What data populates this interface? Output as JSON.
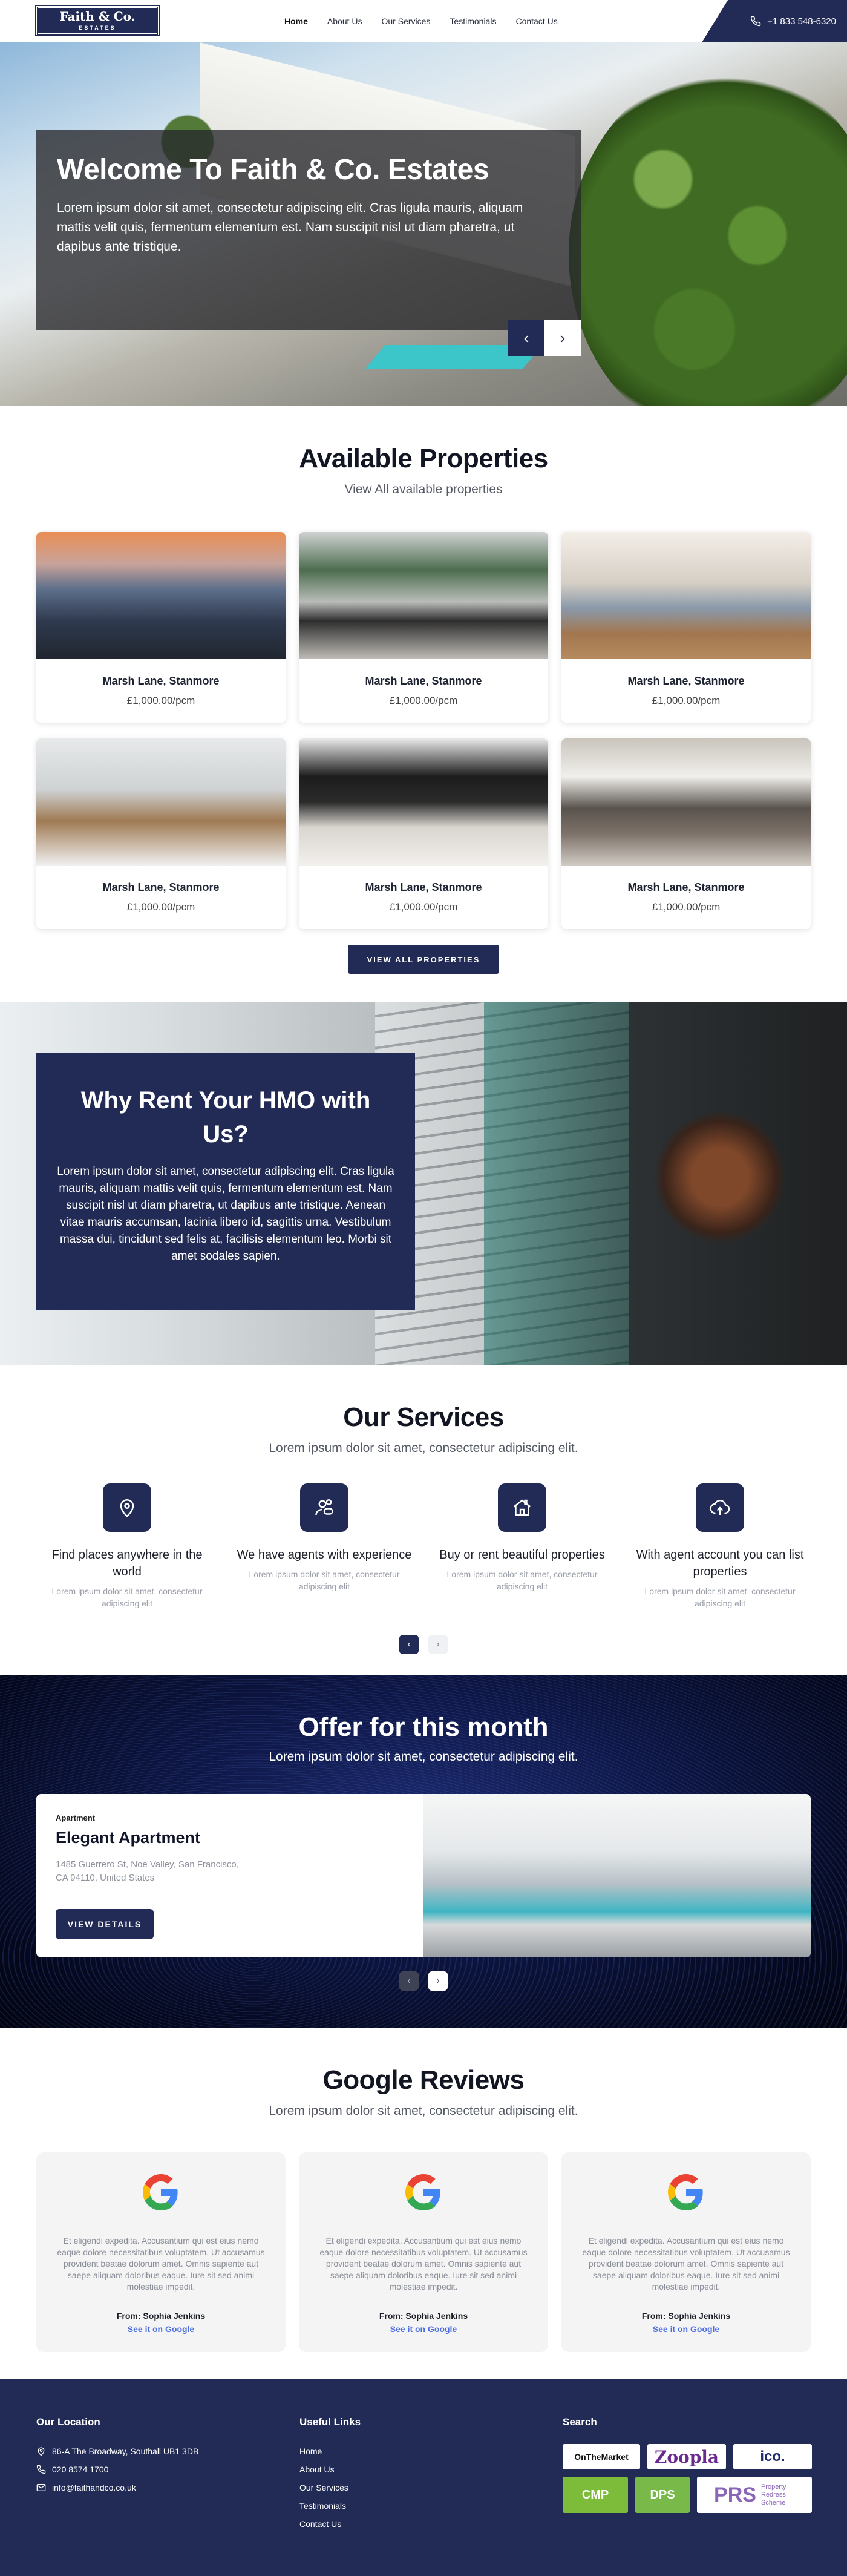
{
  "nav": {
    "logo_line1": "Faith & Co.",
    "logo_line2": "ESTATES",
    "links": [
      "Home",
      "About Us",
      "Our Services",
      "Testimonials",
      "Contact Us"
    ],
    "phone": "+1 833 548-6320"
  },
  "hero": {
    "title": "Welcome To Faith & Co. Estates",
    "text": "Lorem ipsum dolor sit amet, consectetur adipiscing elit. Cras ligula mauris, aliquam mattis velit quis, fermentum elementum est. Nam suscipit nisl ut diam pharetra, ut dapibus ante tristique.",
    "prev_icon": "chevron-left-icon",
    "next_icon": "chevron-right-icon"
  },
  "properties": {
    "title": "Available Properties",
    "subtitle": "View All available properties",
    "items": [
      {
        "name": "Marsh Lane, Stanmore",
        "price": "£1,000.00/pcm"
      },
      {
        "name": "Marsh Lane, Stanmore",
        "price": "£1,000.00/pcm"
      },
      {
        "name": "Marsh Lane, Stanmore",
        "price": "£1,000.00/pcm"
      },
      {
        "name": "Marsh Lane, Stanmore",
        "price": "£1,000.00/pcm"
      },
      {
        "name": "Marsh Lane, Stanmore",
        "price": "£1,000.00/pcm"
      },
      {
        "name": "Marsh Lane, Stanmore",
        "price": "£1,000.00/pcm"
      }
    ],
    "button": "VIEW ALL PROPERTIES"
  },
  "why": {
    "title": "Why Rent Your HMO with Us?",
    "text": "Lorem ipsum dolor sit amet, consectetur adipiscing elit. Cras ligula mauris, aliquam mattis velit quis, fermentum elementum est. Nam suscipit nisl ut diam pharetra, ut dapibus ante tristique. Aenean vitae mauris accumsan, lacinia libero id, sagittis urna. Vestibulum massa dui, tincidunt sed felis at, facilisis elementum leo. Morbi sit amet sodales sapien."
  },
  "services": {
    "title": "Our Services",
    "subtitle": "Lorem ipsum dolor sit amet, consectetur adipiscing elit.",
    "items": [
      {
        "title": "Find places anywhere in the world",
        "desc": "Lorem ipsum dolor sit amet, consectetur adipiscing elit",
        "icon": "location-pin-icon"
      },
      {
        "title": "We have agents with experience",
        "desc": "Lorem ipsum dolor sit amet, consectetur adipiscing elit",
        "icon": "agents-icon"
      },
      {
        "title": "Buy or rent beautiful properties",
        "desc": "Lorem ipsum dolor sit amet, consectetur adipiscing elit",
        "icon": "house-icon"
      },
      {
        "title": "With agent account you can list properties",
        "desc": "Lorem ipsum dolor sit amet, consectetur adipiscing elit",
        "icon": "cloud-upload-icon"
      }
    ]
  },
  "offer": {
    "title": "Offer for this month",
    "subtitle": "Lorem ipsum dolor sit amet, consectetur adipiscing elit.",
    "category": "Apartment",
    "name": "Elegant Apartment",
    "address": "1485 Guerrero St, Noe Valley, San Francisco, CA 94110, United States",
    "button": "VIEW DETAILS"
  },
  "reviews": {
    "title": "Google Reviews",
    "subtitle": "Lorem ipsum dolor sit amet, consectetur adipiscing elit.",
    "items": [
      {
        "text": "Et eligendi expedita. Accusantium qui est eius nemo eaque dolore necessitatibus voluptatem. Ut accusamus provident beatae dolorum amet. Omnis sapiente aut saepe aliquam doloribus eaque. Iure sit sed animi molestiae impedit.",
        "from": "From: Sophia Jenkins",
        "link": "See it on Google"
      },
      {
        "text": "Et eligendi expedita. Accusantium qui est eius nemo eaque dolore necessitatibus voluptatem. Ut accusamus provident beatae dolorum amet. Omnis sapiente aut saepe aliquam doloribus eaque. Iure sit sed animi molestiae impedit.",
        "from": "From: Sophia Jenkins",
        "link": "See it on Google"
      },
      {
        "text": "Et eligendi expedita. Accusantium qui est eius nemo eaque dolore necessitatibus voluptatem. Ut accusamus provident beatae dolorum amet. Omnis sapiente aut saepe aliquam doloribus eaque. Iure sit sed animi molestiae impedit.",
        "from": "From: Sophia Jenkins",
        "link": "See it on Google"
      }
    ]
  },
  "footer": {
    "location_title": "Our Location",
    "address": "86-A The Broadway, Southall UB1 3DB",
    "phone": "020 8574 1700",
    "email": "info@faithandco.co.uk",
    "links_title": "Useful Links",
    "links": [
      "Home",
      "About Us",
      "Our Services",
      "Testimonials",
      "Contact Us"
    ],
    "search_title": "Search",
    "badges": [
      "OnTheMarket",
      "Zoopla",
      "ico.",
      "CMP",
      "DPS",
      "PRS",
      "Property Redress Scheme"
    ]
  },
  "colors": {
    "primary": "#212b55",
    "accent_link": "#4a6de0"
  }
}
